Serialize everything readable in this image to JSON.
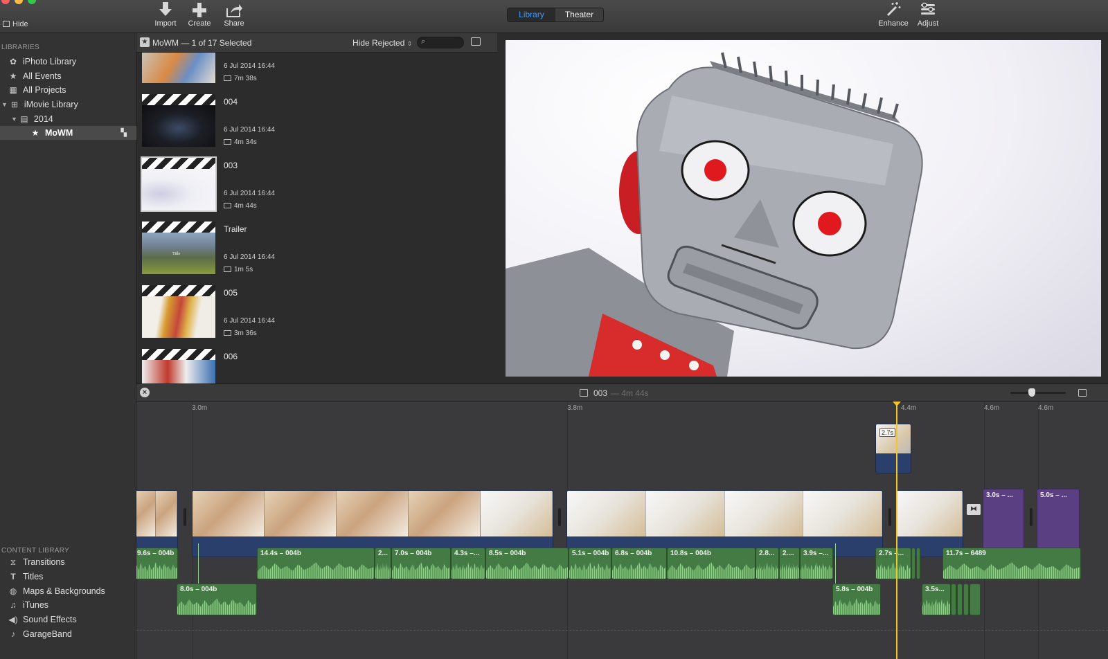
{
  "toolbar": {
    "hide_label": "Hide",
    "import_label": "Import",
    "create_label": "Create",
    "share_label": "Share",
    "library_tab": "Library",
    "theater_tab": "Theater",
    "enhance_label": "Enhance",
    "adjust_label": "Adjust",
    "traffic_colors": [
      "#fc605c",
      "#fdbc40",
      "#34c84a"
    ]
  },
  "sidebar": {
    "libraries_heading": "LIBRARIES",
    "items": [
      {
        "label": "iPhoto Library",
        "icon": "iphoto-icon"
      },
      {
        "label": "All Events",
        "icon": "star-icon"
      },
      {
        "label": "All Projects",
        "icon": "grid-icon"
      },
      {
        "label": "iMovie Library",
        "icon": "library-icon"
      },
      {
        "label": "2014",
        "icon": "calendar-icon"
      },
      {
        "label": "MoWM",
        "icon": "star-icon"
      }
    ],
    "content_heading": "CONTENT LIBRARY",
    "content_items": [
      {
        "label": "Transitions",
        "icon": "transitions-icon"
      },
      {
        "label": "Titles",
        "icon": "titles-icon"
      },
      {
        "label": "Maps & Backgrounds",
        "icon": "globe-icon"
      },
      {
        "label": "iTunes",
        "icon": "music-note-icon"
      },
      {
        "label": "Sound Effects",
        "icon": "speaker-icon"
      },
      {
        "label": "GarageBand",
        "icon": "guitar-icon"
      }
    ]
  },
  "browser": {
    "title": "MoWM — 1 of 17 Selected",
    "filter": "Hide Rejected",
    "clips": [
      {
        "name": "",
        "date": "6 Jul 2014 16:44",
        "duration": "7m 38s"
      },
      {
        "name": "004",
        "date": "6 Jul 2014 16:44",
        "duration": "4m 34s"
      },
      {
        "name": "003",
        "date": "6 Jul 2014 16:44",
        "duration": "4m 44s"
      },
      {
        "name": "Trailer",
        "date": "6 Jul 2014 16:44",
        "duration": "1m 5s"
      },
      {
        "name": "005",
        "date": "6 Jul 2014 16:44",
        "duration": "3m 36s"
      },
      {
        "name": "006",
        "date": "",
        "duration": ""
      }
    ],
    "trailer_thumb_text": "Title"
  },
  "timeline": {
    "project_name": "003",
    "project_duration": "— 4m 44s",
    "ruler": [
      "3.0m",
      "3.8m",
      "4.4m",
      "4.6m",
      "4.6m"
    ],
    "cutaway_label": "2.7s",
    "purple_clips": [
      "3.0s – ...",
      "5.0s – ..."
    ],
    "audio_row1": [
      "9.6s – 004b",
      "14.4s – 004b",
      "2...",
      "7.0s – 004b",
      "4.3s –...",
      "8.5s – 004b",
      "5.1s – 004b",
      "6.8s – 004b",
      "10.8s – 004b",
      "2.8...",
      "2....",
      "3.9s –...",
      "2.7s –...",
      "11.7s – 6489"
    ],
    "audio_row2": [
      "8.0s – 004b",
      "5.8s – 004b",
      "3.5s..."
    ],
    "playhead_color": "#f3c623"
  }
}
